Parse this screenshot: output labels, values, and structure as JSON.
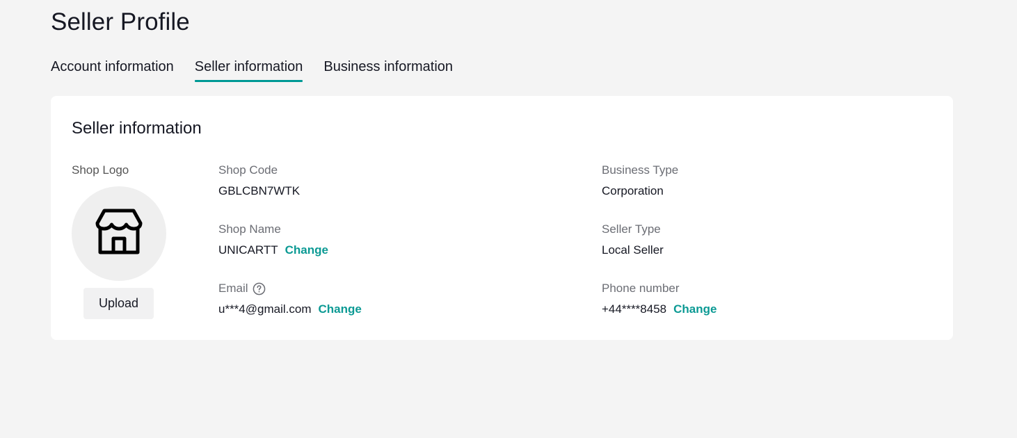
{
  "page": {
    "title": "Seller Profile"
  },
  "tabs": [
    {
      "label": "Account information",
      "active": false
    },
    {
      "label": "Seller information",
      "active": true
    },
    {
      "label": "Business information",
      "active": false
    }
  ],
  "card": {
    "title": "Seller information",
    "logo": {
      "label": "Shop Logo",
      "icon": "store-icon",
      "upload_label": "Upload"
    },
    "fields": {
      "shop_code": {
        "label": "Shop Code",
        "value": "GBLCBN7WTK"
      },
      "shop_name": {
        "label": "Shop Name",
        "value": "UNICARTT",
        "action": "Change"
      },
      "email": {
        "label": "Email",
        "value": "u***4@gmail.com",
        "action": "Change",
        "icon": "help-icon"
      },
      "business_type": {
        "label": "Business Type",
        "value": "Corporation"
      },
      "seller_type": {
        "label": "Seller Type",
        "value": "Local Seller"
      },
      "phone": {
        "label": "Phone number",
        "value": "+44****8458",
        "action": "Change"
      }
    }
  },
  "colors": {
    "accent": "#009995",
    "link": "#0c9a94",
    "background": "#f4f4f4"
  }
}
